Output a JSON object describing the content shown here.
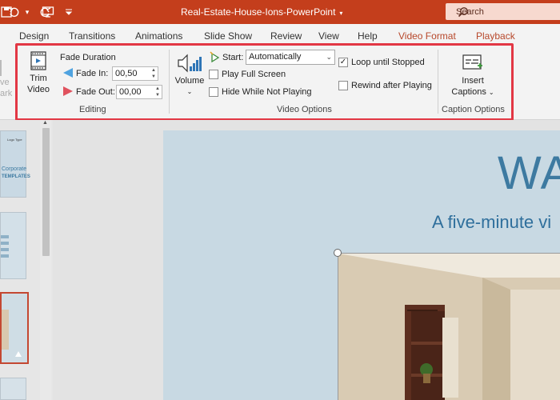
{
  "titlebar": {
    "title": "Real-Estate-House-Ions-PowerPoint",
    "title_caret": "▾",
    "search_label": "Search",
    "bg_color": "#c43e1c",
    "icons": [
      "save-icon",
      "undo-icon",
      "redo-icon",
      "present-icon",
      "customize-qat-icon"
    ]
  },
  "tabs": {
    "items": [
      "Design",
      "Transitions",
      "Animations",
      "Slide Show",
      "Review",
      "View",
      "Help",
      "Video Format",
      "Playback"
    ],
    "active": "Playback"
  },
  "ribbon": {
    "cut_left_1": "ve",
    "cut_left_2": "ark",
    "trim_video": [
      "Trim",
      "Video"
    ],
    "fade_duration": "Fade Duration",
    "fade_in_label": "Fade In:",
    "fade_in_value": "00,50",
    "fade_out_label": "Fade Out:",
    "fade_out_value": "00,00",
    "editing_group": "Editing",
    "volume_label": "Volume",
    "start_label": "Start:",
    "start_value": "Automatically",
    "play_full_screen": "Play Full Screen",
    "hide_while_not_playing": "Hide While Not Playing",
    "loop_until_stopped": "Loop until Stopped",
    "rewind_after_playing": "Rewind after Playing",
    "loop_checked": true,
    "video_options_group": "Video Options",
    "insert_captions": [
      "Insert",
      "Captions"
    ],
    "caption_options_group": "Caption Options",
    "highlight_color": "#e23744"
  },
  "slides_panel": {
    "thumb1_line1": "Corporate",
    "thumb1_line2": "TEMPLATES",
    "selected_border_color": "#c44832"
  },
  "slide": {
    "title": "WA",
    "subtitle": "A five-minute vi",
    "title_color": "#3d7aa1"
  }
}
